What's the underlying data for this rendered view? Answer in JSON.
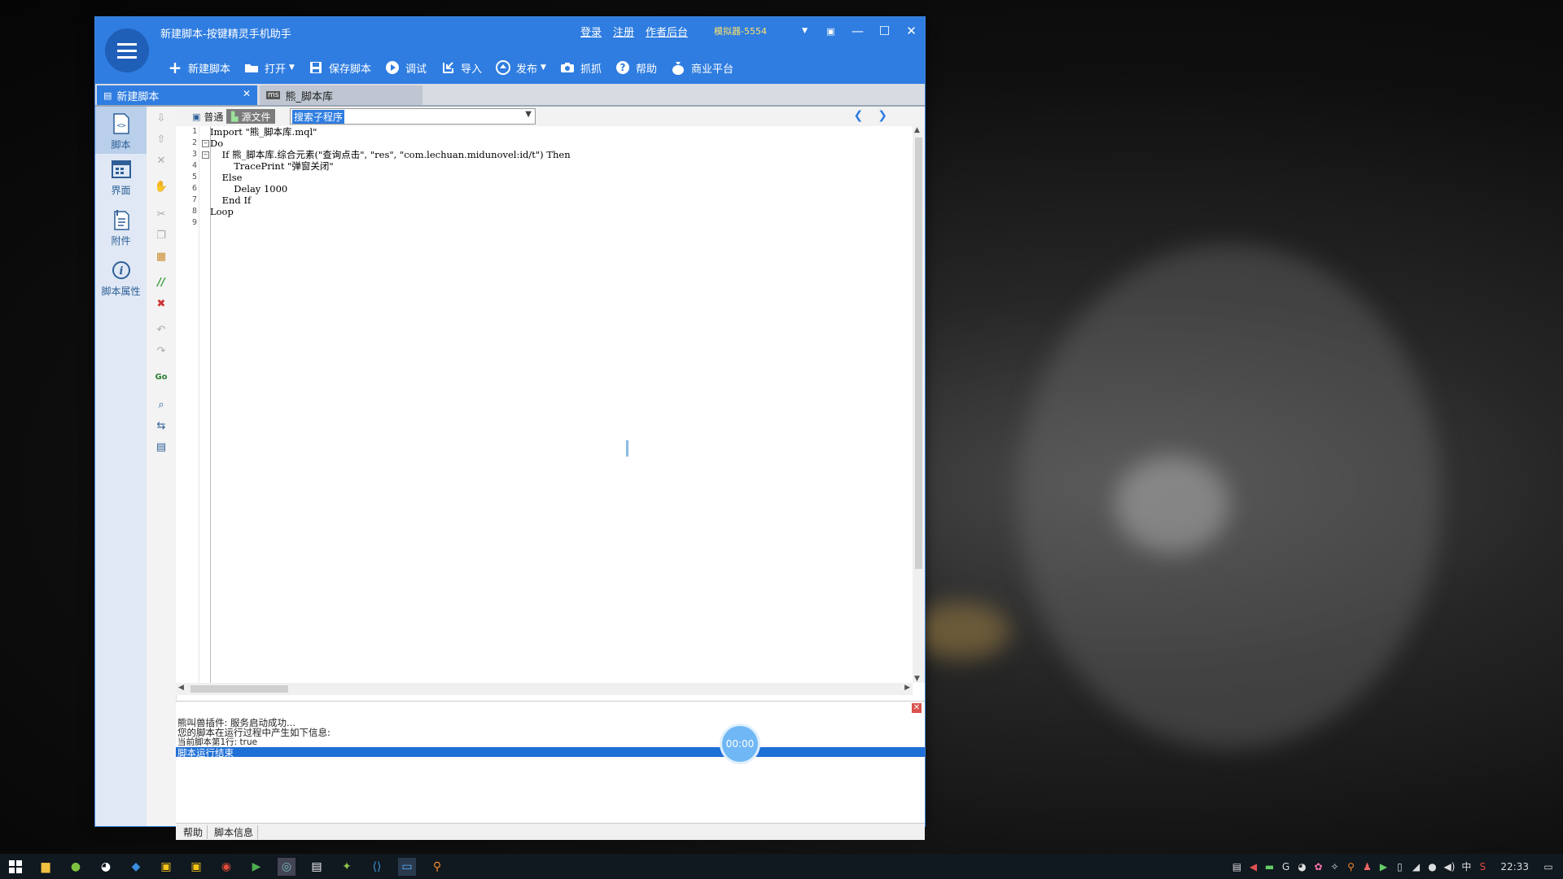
{
  "window": {
    "title": "新建脚本-按键精灵手机助手",
    "links": [
      "登录",
      "注册",
      "作者后台"
    ],
    "device": "模拟器-5554"
  },
  "toolbar": {
    "new": "新建脚本",
    "open": "打开",
    "save": "保存脚本",
    "debug": "调试",
    "import": "导入",
    "publish": "发布",
    "capture": "抓抓",
    "help": "帮助",
    "business": "商业平台"
  },
  "tabs": {
    "active": "新建脚本",
    "inactive": "熊_脚本库"
  },
  "leftnav": {
    "items": [
      "脚本",
      "界面",
      "附件",
      "脚本属性"
    ]
  },
  "editor": {
    "mode_normal": "普通",
    "mode_source": "源文件",
    "search_placeholder": "搜索子程序",
    "line_numbers": [
      "1",
      "2",
      "3",
      "4",
      "5",
      "6",
      "7",
      "8",
      "9"
    ],
    "lines": [
      "Import \"熊_脚本库.mql\"",
      "Do",
      "    If 熊_脚本库.综合元素(\"查询点击\", \"res\", \"com.lechuan.midunovel:id/t\") Then",
      "        TracePrint \"弹窗关闭\"",
      "    Else",
      "        Delay 1000",
      "    End If",
      "Loop",
      ""
    ]
  },
  "output": {
    "lines": [
      "熊叫兽插件: 服务启动成功...",
      "您的脚本在运行过程中产生如下信息:",
      "当前脚本第1行: true",
      "脚本运行结束"
    ],
    "timer": "00:00"
  },
  "bottom_tabs": [
    "帮助",
    "脚本信息"
  ],
  "taskbar": {
    "clock": "22:33",
    "ime": "中"
  },
  "colors": {
    "accent": "#2f7de0",
    "selection": "#1e6fd6"
  }
}
